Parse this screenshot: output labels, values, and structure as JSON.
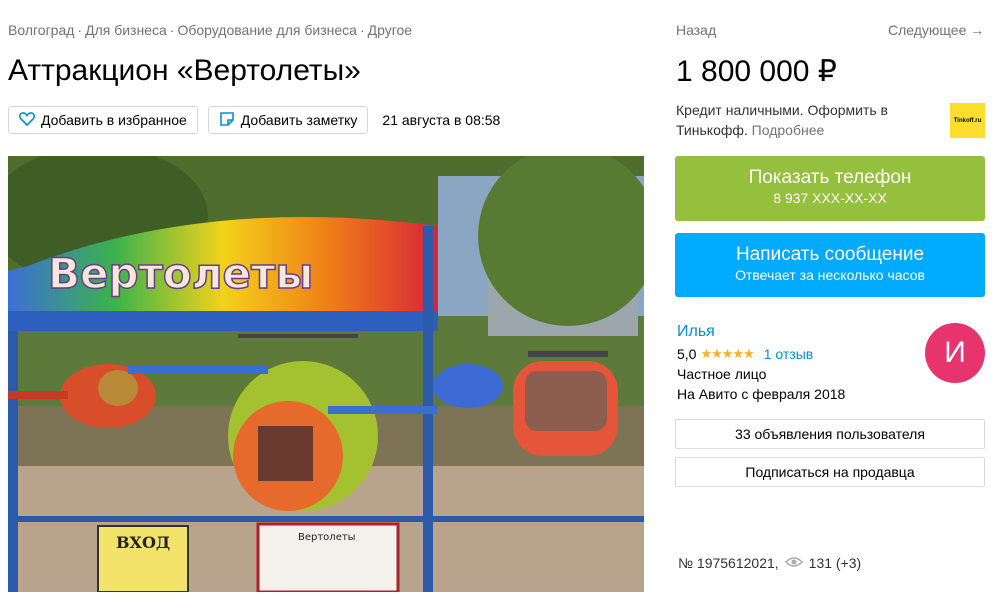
{
  "breadcrumb": [
    "Волгоград",
    "Для бизнеса",
    "Оборудование для бизнеса",
    "Другое"
  ],
  "title": "Аттракцион «Вертолеты»",
  "actions": {
    "favorite": "Добавить в избранное",
    "note": "Добавить заметку",
    "date": "21 августа в 08:58"
  },
  "photo": {
    "sign_text": "Вертолеты",
    "entrance_sign": "ВХОД",
    "info_board": "Вертолеты"
  },
  "nav": {
    "back": "Назад",
    "next": "Следующее →"
  },
  "price": "1 800 000 ₽",
  "credit": {
    "text": "Кредит наличными. Оформить в Тинькофф.",
    "more": "Подробнее",
    "logo": "Tinkoff.ru"
  },
  "phone_button": {
    "label": "Показать телефон",
    "number": "8 937 XXX-XX-XX"
  },
  "message_button": {
    "label": "Написать сообщение",
    "sub": "Отвечает за несколько часов"
  },
  "seller": {
    "name": "Илья",
    "rating": "5,0",
    "stars": "★★★★★",
    "reviews": "1 отзыв",
    "type": "Частное лицо",
    "since": "На Авито с февраля 2018",
    "avatar_letter": "И"
  },
  "seller_buttons": {
    "ads": "33 объявления пользователя",
    "subscribe": "Подписаться на продавца"
  },
  "footer": {
    "id": "№ 1975612021,",
    "views": "131 (+3)"
  },
  "colors": {
    "green": "#95c03e",
    "blue": "#00aaff",
    "link": "#0091d9",
    "avatar": "#e8346e"
  }
}
